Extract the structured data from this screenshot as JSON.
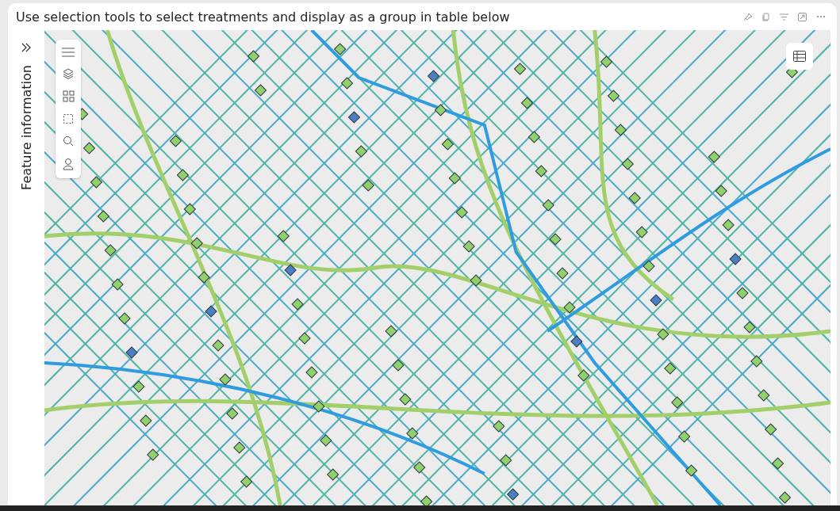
{
  "visual": {
    "title": "Use selection tools to select treatments and display as a group in table below"
  },
  "side_panel": {
    "label": "Feature information"
  }
}
